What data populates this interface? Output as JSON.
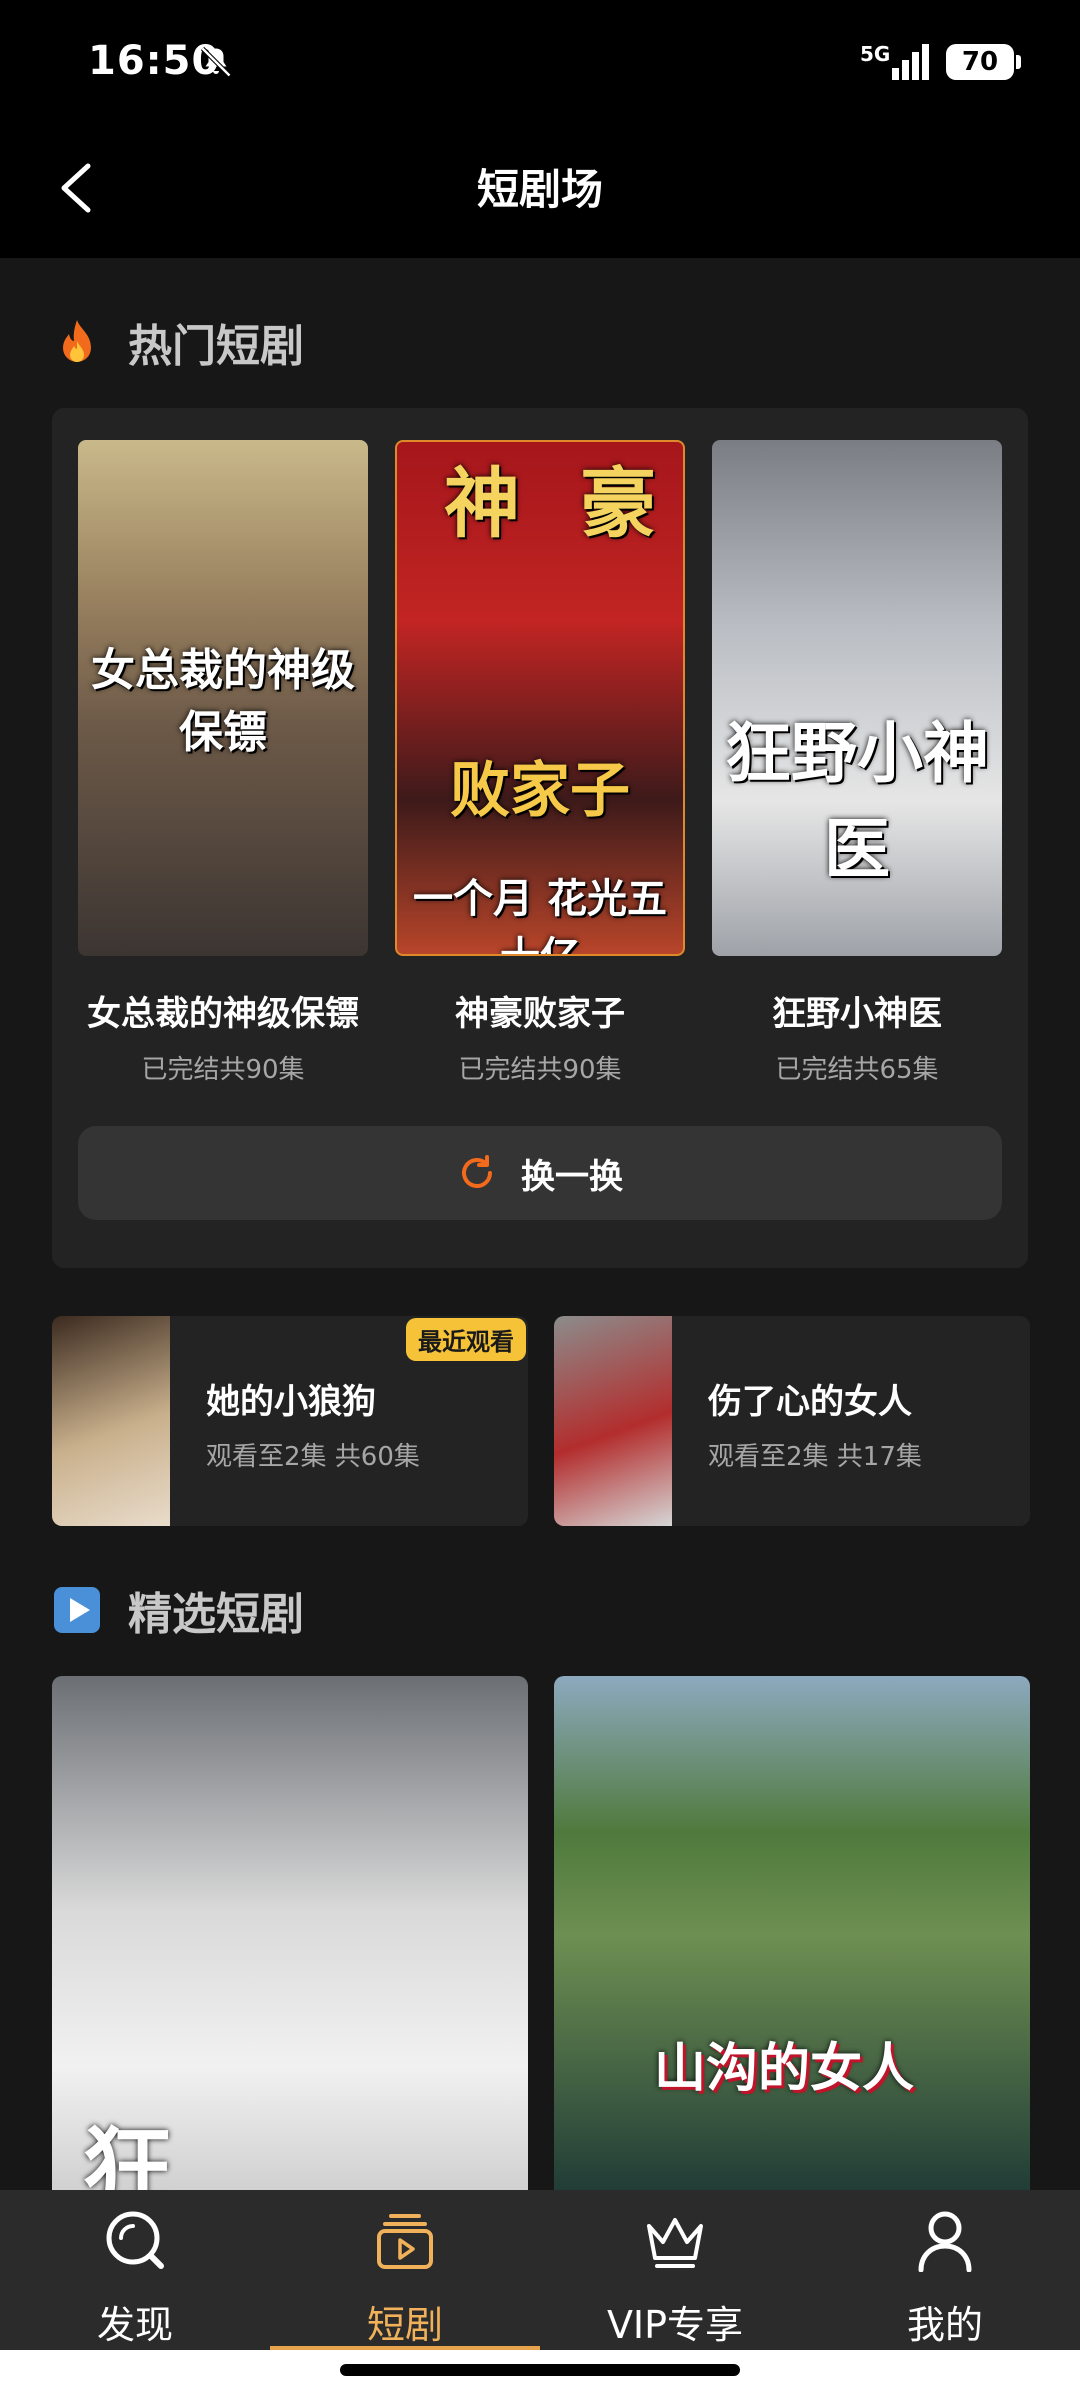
{
  "status": {
    "time": "16:50",
    "network": "5G",
    "battery": "70"
  },
  "nav": {
    "title": "短剧场"
  },
  "hot": {
    "title": "热门短剧",
    "items": [
      {
        "name": "女总裁的神级保镖",
        "meta": "已完结共90集",
        "poster_text": "女总裁的神级保镖"
      },
      {
        "name": "神豪败家子",
        "meta": "已完结共90集",
        "poster_line1": "神豪",
        "poster_line2": "败家子",
        "poster_line3": "一个月 花光五十亿"
      },
      {
        "name": "狂野小神医",
        "meta": "已完结共65集",
        "poster_text": "狂野小神医"
      }
    ],
    "swap_label": "换一换"
  },
  "recent": {
    "badge": "最近观看",
    "items": [
      {
        "title": "她的小狼狗",
        "meta": "观看至2集 共60集"
      },
      {
        "title": "伤了心的女人",
        "meta": "观看至2集 共17集"
      }
    ]
  },
  "featured": {
    "title": "精选短剧",
    "items": [
      {
        "poster_text": "狂"
      },
      {
        "poster_text": "山沟的女人"
      }
    ]
  },
  "tabs": [
    {
      "label": "发现",
      "icon": "discover-icon"
    },
    {
      "label": "短剧",
      "icon": "short-drama-icon"
    },
    {
      "label": "VIP专享",
      "icon": "crown-icon"
    },
    {
      "label": "我的",
      "icon": "profile-icon"
    }
  ],
  "colors": {
    "accent": "#f0b15a",
    "badge": "#f6c338",
    "background": "#171717"
  }
}
